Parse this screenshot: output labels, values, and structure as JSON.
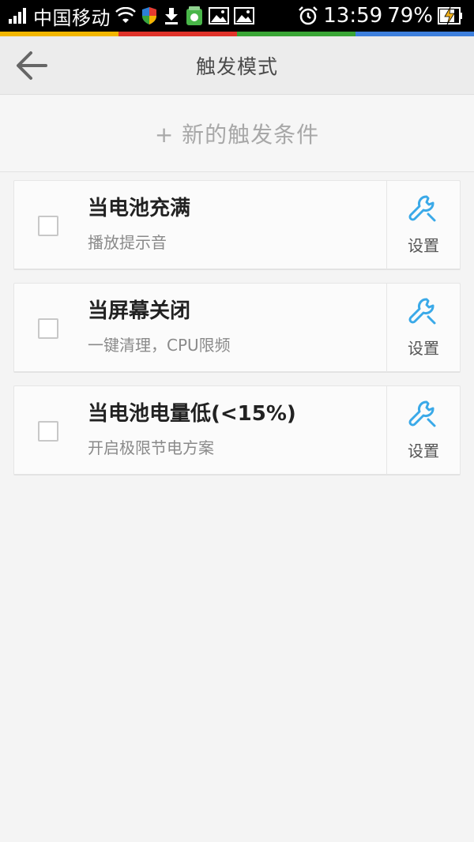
{
  "status_bar": {
    "carrier": "中国移动",
    "time": "13:59",
    "battery": "79%",
    "icons": [
      "signal-icon",
      "wifi-icon",
      "shield-icon",
      "download-icon",
      "app-icon",
      "image-icon",
      "image-icon",
      "alarm-icon",
      "battery-charging-icon"
    ]
  },
  "colors": {
    "strip": [
      "#f2b600",
      "#e0332a",
      "#39a535",
      "#3d7fdc"
    ],
    "accent": "#3aa9e8"
  },
  "header": {
    "title": "触发模式"
  },
  "new_trigger": {
    "label": "+ 新的触发条件"
  },
  "triggers": [
    {
      "title": "当电池充满",
      "subtitle": "播放提示音",
      "settings_label": "设置",
      "checked": false
    },
    {
      "title": "当屏幕关闭",
      "subtitle": "一键清理，CPU限频",
      "settings_label": "设置",
      "checked": false
    },
    {
      "title": "当电池电量低(<15%)",
      "subtitle": "开启极限节电方案",
      "settings_label": "设置",
      "checked": false
    }
  ]
}
